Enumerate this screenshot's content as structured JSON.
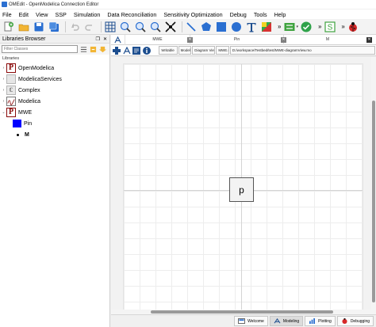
{
  "window": {
    "title": "OMEdit - OpenModelica Connection Editor"
  },
  "menu": [
    "File",
    "Edit",
    "View",
    "SSP",
    "Simulation",
    "Data Reconciliation",
    "Sensitivity Optimization",
    "Debug",
    "Tools",
    "Help"
  ],
  "toolbar": {
    "more_glyph": "»"
  },
  "libraries_browser": {
    "title": "Libraries Browser",
    "filter_placeholder": "Filter Classes",
    "section_label": "Libraries",
    "items": [
      {
        "label": "OpenModelica",
        "icon": "modelica-p-icon"
      },
      {
        "label": "ModelicaServices",
        "icon": "package-grey-icon"
      },
      {
        "label": "Complex",
        "icon": "complex-c-icon"
      },
      {
        "label": "Modelica",
        "icon": "modelica-library-icon"
      },
      {
        "label": "MWE",
        "icon": "modelica-p-icon"
      },
      {
        "label": "Pin",
        "icon": "blue-square-icon"
      },
      {
        "label": "M",
        "icon": "bullet-icon"
      }
    ]
  },
  "tabs": [
    {
      "label": "MWE"
    },
    {
      "label": "Pin"
    },
    {
      "label": "M"
    }
  ],
  "view_bar": {
    "writable": "Writable",
    "model": "Model",
    "diagram_view": "Diagram View",
    "class_name": "MWE.M",
    "path": "D:/workspace/Testbed/test/MWE-diagramView.mo"
  },
  "diagram": {
    "component_label": "p"
  },
  "perspectives": [
    {
      "label": "Welcome"
    },
    {
      "label": "Modeling"
    },
    {
      "label": "Plotting"
    },
    {
      "label": "Debugging"
    }
  ],
  "colors": {
    "accent_blue": "#2a6fd1",
    "modelica_red": "#8a0a0a",
    "pin_blue": "#0000ff"
  }
}
